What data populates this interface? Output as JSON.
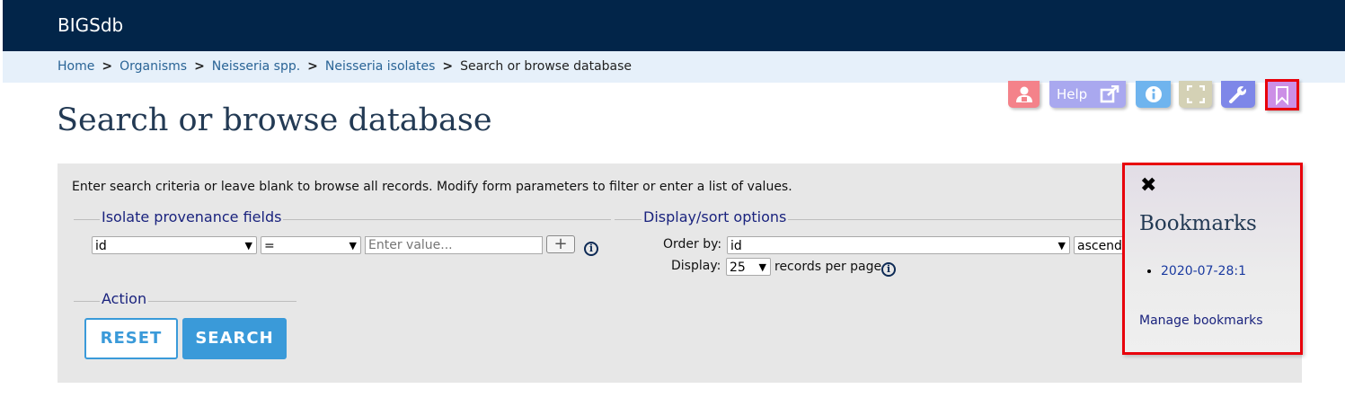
{
  "app": {
    "brand": "BIGSdb"
  },
  "breadcrumb": {
    "items": [
      "Home",
      "Organisms",
      "Neisseria spp.",
      "Neisseria isolates"
    ],
    "current": "Search or browse database",
    "separator": ">"
  },
  "toolbar": {
    "help_label": "Help",
    "buttons": [
      {
        "icon": "user-admin-icon",
        "color": "#f4828a"
      },
      {
        "icon": "help-external-link-icon",
        "color": "#a9a8ef"
      },
      {
        "icon": "info-icon",
        "color": "#6fb4ee"
      },
      {
        "icon": "fullscreen-icon",
        "color": "#d4d1b5"
      },
      {
        "icon": "wrench-icon",
        "color": "#7e87e8"
      },
      {
        "icon": "bookmark-icon",
        "color": "#cc8fe6"
      }
    ]
  },
  "page": {
    "title": "Search or browse database"
  },
  "form": {
    "instructions": "Enter search criteria or leave blank to browse all records. Modify form parameters to filter or enter a list of values.",
    "provenance": {
      "legend": "Isolate provenance fields",
      "field_value": "id",
      "operator_value": "=",
      "value_placeholder": "Enter value...",
      "add_label": "+"
    },
    "display": {
      "legend": "Display/sort options",
      "order_by_label": "Order by:",
      "order_by_value": "id",
      "direction_value": "ascend",
      "display_label": "Display:",
      "display_value": "25",
      "records_per_page": "records per page"
    },
    "action": {
      "legend": "Action",
      "reset_label": "RESET",
      "search_label": "SEARCH"
    }
  },
  "bookmarks": {
    "close": "✖",
    "title": "Bookmarks",
    "items": [
      "2020-07-28:1"
    ],
    "manage_label": "Manage bookmarks"
  },
  "colors": {
    "header_bg": "#022549",
    "breadcrumb_bg": "#e6f0fa",
    "panel_bg": "#e7e7e7",
    "accent_blue": "#3a9ad9",
    "highlight_red": "#e8000b"
  }
}
